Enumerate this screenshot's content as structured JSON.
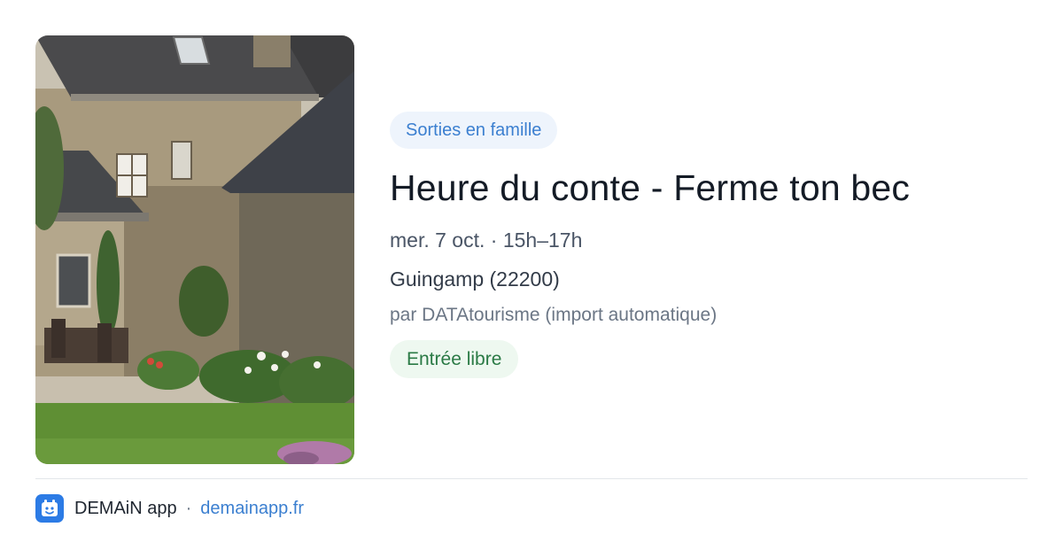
{
  "event": {
    "category": "Sorties en famille",
    "title": "Heure du conte - Ferme ton bec",
    "when": "mer. 7 oct. · 15h–17h",
    "where": "Guingamp (22200)",
    "organizer": "par DATAtourisme (import automatique)",
    "price": "Entrée libre"
  },
  "footer": {
    "app_name": "DEMAiN app",
    "separator": "·",
    "domain": "demainapp.fr"
  },
  "colors": {
    "accent": "#3b7fd0",
    "category_bg": "#eef4fc",
    "price_text": "#2a7a45",
    "price_bg": "#eef8f0",
    "logo_bg": "#2c7be5"
  },
  "icons": {
    "app_logo": "calendar-smile-icon"
  }
}
